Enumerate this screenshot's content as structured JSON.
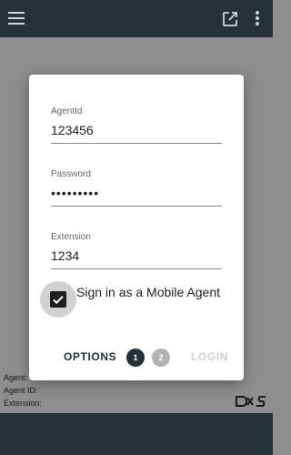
{
  "topbar": {
    "menu_icon": "hamburger-menu-icon",
    "popout_icon": "open-in-new-icon",
    "more_icon": "more-vert-icon"
  },
  "login_dialog": {
    "agent_id": {
      "label": "AgentId",
      "value": "123456"
    },
    "password": {
      "label": "Password",
      "value": "•••••••••"
    },
    "extension": {
      "label": "Extension",
      "value": "1234"
    },
    "mobile_agent": {
      "label": "Sign in as a Mobile Agent",
      "checked": true
    },
    "options_label": "OPTIONS",
    "steps": [
      "1",
      "2"
    ],
    "current_step": "1",
    "login_label": "LOGIN"
  },
  "agent_info": {
    "agent_label": "Agent:",
    "agent_id_label": "Agent ID:",
    "extension_label": "Extension:"
  },
  "colors": {
    "app_bar": "#263238",
    "active_step": "#263238",
    "inactive_step": "#b3b3b3",
    "backdrop": "#8e8e8e"
  }
}
